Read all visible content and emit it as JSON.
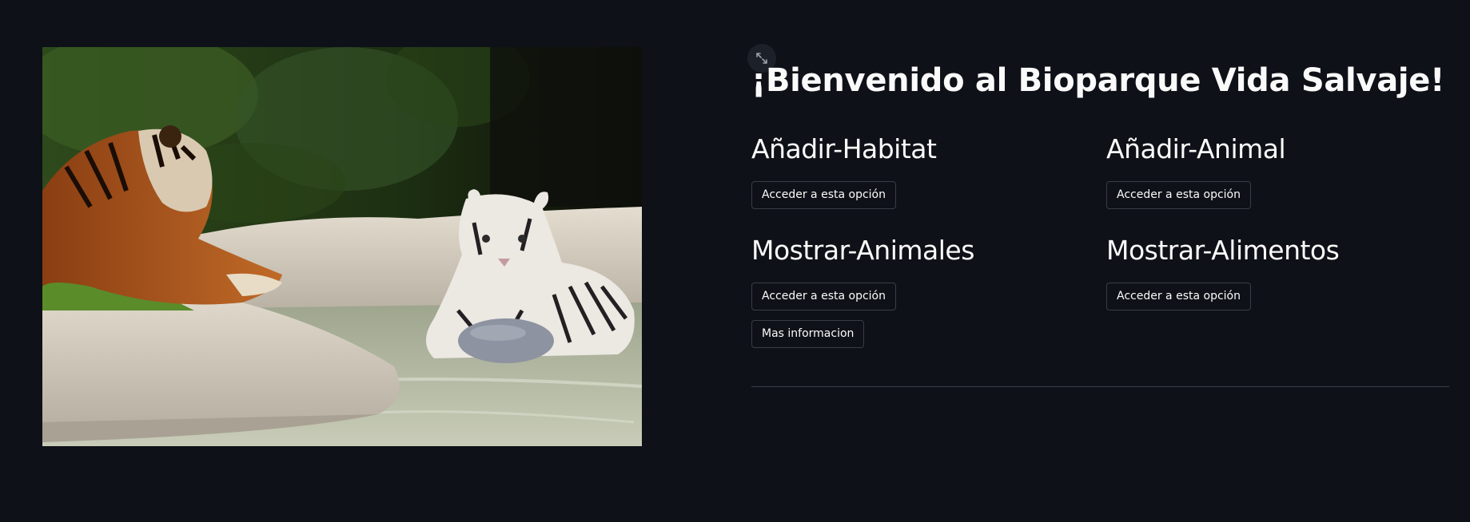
{
  "page": {
    "title": "¡Bienvenido al Bioparque Vida Salvaje!",
    "image": {
      "icon": "tigers-photo"
    },
    "fullscreen": {
      "icon": "expand-icon"
    }
  },
  "options": [
    {
      "heading": "Añadir-Habitat",
      "button_label": "Acceder a esta opción"
    },
    {
      "heading": "Añadir-Animal",
      "button_label": "Acceder a esta opción"
    },
    {
      "heading": "Mostrar-Animales",
      "button_label": "Acceder a esta opción"
    },
    {
      "heading": "Mostrar-Alimentos",
      "button_label": "Acceder a esta opción"
    }
  ],
  "more_info": {
    "label": "Mas informacion"
  },
  "colors": {
    "background": "#0e1117",
    "text": "#fafafa",
    "button_border": "#3a3d46"
  }
}
